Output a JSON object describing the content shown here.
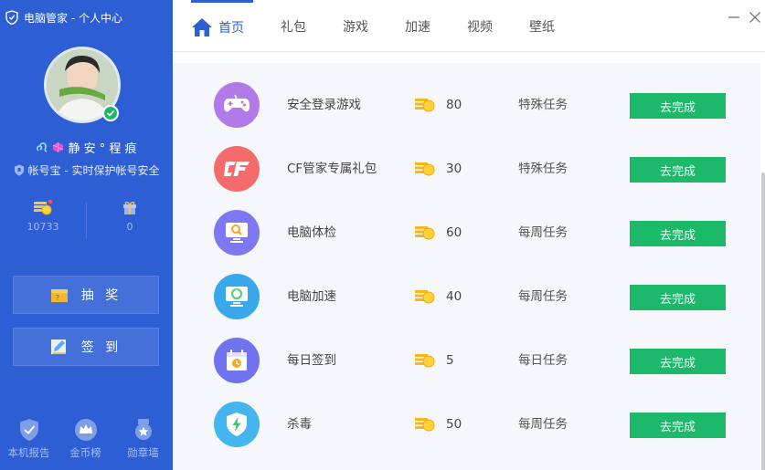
{
  "app": {
    "title": "电脑管家 - 个人中心"
  },
  "profile": {
    "username": "静 安 ° 程 痕",
    "guard_text": "帐号宝 - 实时保护帐号安全"
  },
  "stats": {
    "coins": "10733",
    "gifts": "0"
  },
  "actions": {
    "lottery": "抽 奖",
    "signin": "签 到"
  },
  "bottom_nav": [
    {
      "label": "本机报告",
      "icon": "shield-check-icon"
    },
    {
      "label": "金币榜",
      "icon": "crown-icon"
    },
    {
      "label": "勋章墙",
      "icon": "medal-icon"
    }
  ],
  "tabs": [
    {
      "label": "首页",
      "active": true
    },
    {
      "label": "礼包"
    },
    {
      "label": "游戏"
    },
    {
      "label": "加速"
    },
    {
      "label": "视频"
    },
    {
      "label": "壁纸"
    }
  ],
  "tasks": [
    {
      "name": "安全登录游戏",
      "reward": "80",
      "type": "特殊任务",
      "action": "去完成",
      "icon": "gamepad-icon",
      "color": "#b27ae8"
    },
    {
      "name": "CF管家专属礼包",
      "reward": "30",
      "type": "特殊任务",
      "action": "去完成",
      "icon": "cf-logo-icon",
      "color": "#f36b6b"
    },
    {
      "name": "电脑体检",
      "reward": "60",
      "type": "每周任务",
      "action": "去完成",
      "icon": "monitor-search-icon",
      "color": "#7d78ef"
    },
    {
      "name": "电脑加速",
      "reward": "40",
      "type": "每周任务",
      "action": "去完成",
      "icon": "monitor-speed-icon",
      "color": "#38a8ea"
    },
    {
      "name": "每日签到",
      "reward": "5",
      "type": "每日任务",
      "action": "去完成",
      "icon": "calendar-clock-icon",
      "color": "#6f74ee"
    },
    {
      "name": "杀毒",
      "reward": "50",
      "type": "每周任务",
      "action": "去完成",
      "icon": "shield-bolt-icon",
      "color": "#45b5f0"
    }
  ],
  "colors": {
    "sidebar": "#2e5ed3",
    "accent": "#2e5ed3",
    "action_green": "#1db96b"
  }
}
